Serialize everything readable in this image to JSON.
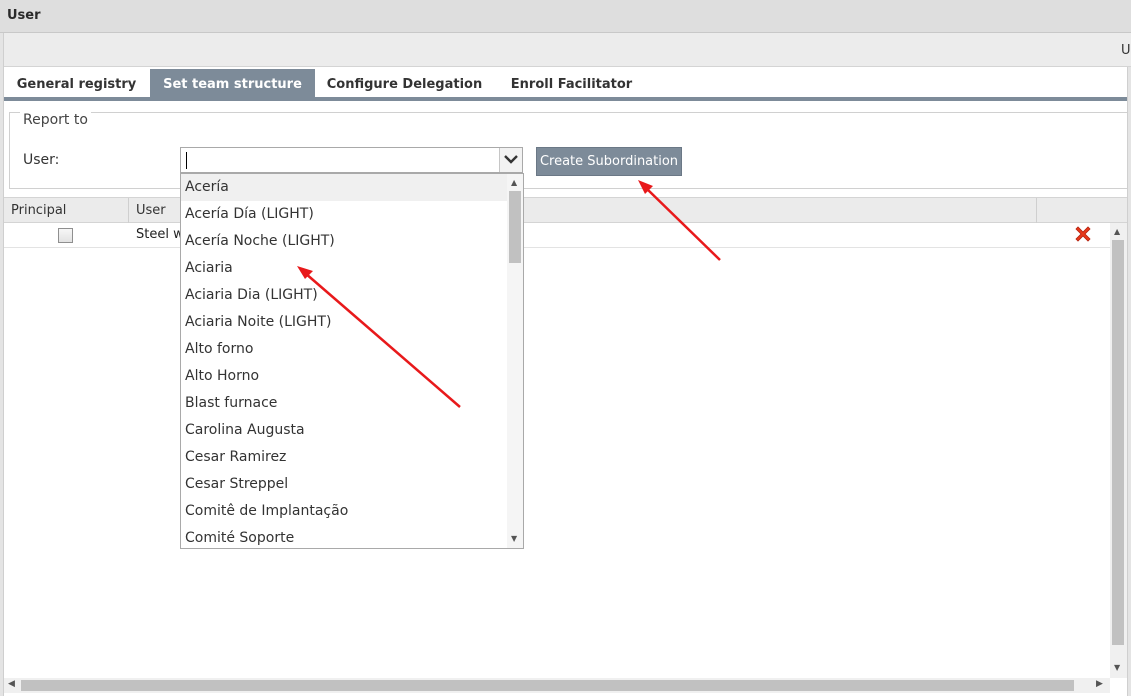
{
  "window": {
    "title": "User",
    "toolbar_cut_text": "U"
  },
  "tabs": [
    {
      "label": "General registry",
      "active": false
    },
    {
      "label": "Set team structure",
      "active": true
    },
    {
      "label": "Configure Delegation",
      "active": false
    },
    {
      "label": "Enroll Facilitator",
      "active": false
    }
  ],
  "report_to": {
    "legend": "Report to",
    "user_label": "User:",
    "user_input_value": "",
    "create_button": "Create Subordination"
  },
  "grid": {
    "columns": [
      "Principal",
      "User"
    ],
    "rows": [
      {
        "principal_checked": false,
        "user": "Steel w"
      }
    ]
  },
  "dropdown": {
    "items": [
      "Acería",
      "Acería Día (LIGHT)",
      "Acería Noche (LIGHT)",
      "Aciaria",
      "Aciaria Dia (LIGHT)",
      "Aciaria Noite (LIGHT)",
      "Alto forno",
      "Alto Horno",
      "Blast furnace",
      "Carolina Augusta",
      "Cesar Ramirez",
      "Cesar Streppel",
      "Comitê de Implantação",
      "Comité Soporte"
    ],
    "highlighted_index": 0
  },
  "colors": {
    "accent": "#7d8b99",
    "annotation_arrow": "#e8191b",
    "delete_icon": "#e8391b"
  },
  "icons": {
    "dropdown_button": "chevron-down-icon",
    "row_delete": "delete-x-icon"
  }
}
